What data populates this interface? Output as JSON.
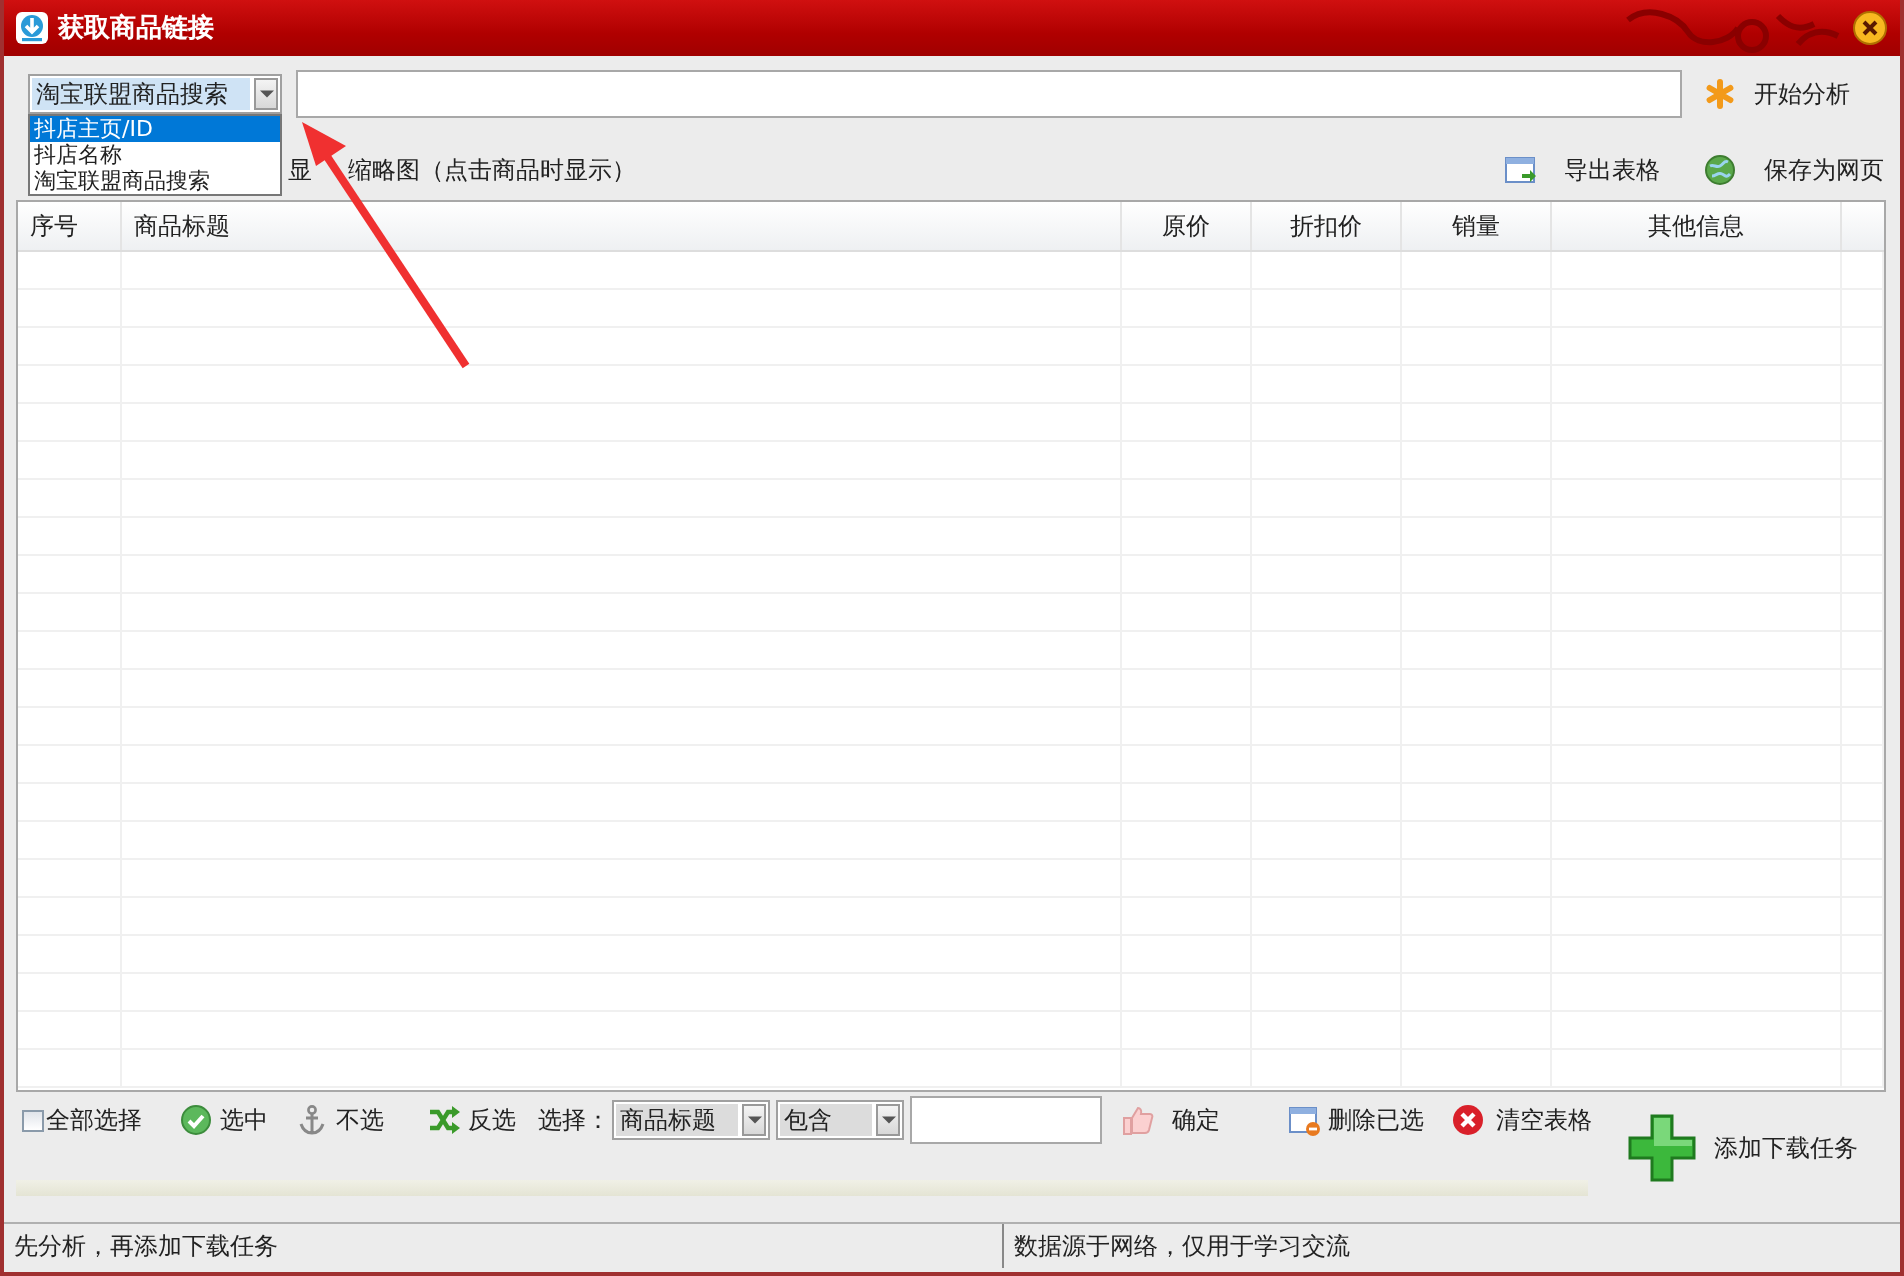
{
  "window": {
    "title": "获取商品链接"
  },
  "search": {
    "mode": "淘宝联盟商品搜索",
    "dropdown_open": true,
    "options": [
      {
        "label": "抖店主页/ID",
        "selected": true
      },
      {
        "label": "抖店名称",
        "selected": false
      },
      {
        "label": "淘宝联盟商品搜索",
        "selected": false
      }
    ],
    "button": "开始分析"
  },
  "options_row": {
    "visible_start": "显",
    "thumbnail_label": "缩略图（点击商品时显示）"
  },
  "actions": [
    {
      "kind": "export",
      "label": "导出表格"
    },
    {
      "kind": "globe",
      "label": "保存为网页"
    }
  ],
  "table": {
    "columns": [
      "序号",
      "商品标题",
      "原价",
      "折扣价",
      "销量",
      "其他信息"
    ]
  },
  "toolbar": {
    "select_all": {
      "label": "全部选择",
      "checked": false
    },
    "buttons": [
      {
        "kind": "check",
        "label": "选中"
      },
      {
        "kind": "anchor",
        "label": "不选"
      },
      {
        "kind": "shuffle",
        "label": "反选"
      }
    ],
    "filter_label": "选择：",
    "field_combo": "商品标题",
    "match_combo": "包含",
    "confirm": {
      "kind": "hand",
      "label": "确定"
    },
    "more": [
      {
        "kind": "delete",
        "label": "删除已选"
      },
      {
        "kind": "clear",
        "label": "清空表格"
      }
    ],
    "add_task": "添加下载任务"
  },
  "progress": {
    "level": 0
  },
  "status_bar": [
    "先分析，再添加下载任务",
    "数据源于网络，仅用于学习交流"
  ]
}
